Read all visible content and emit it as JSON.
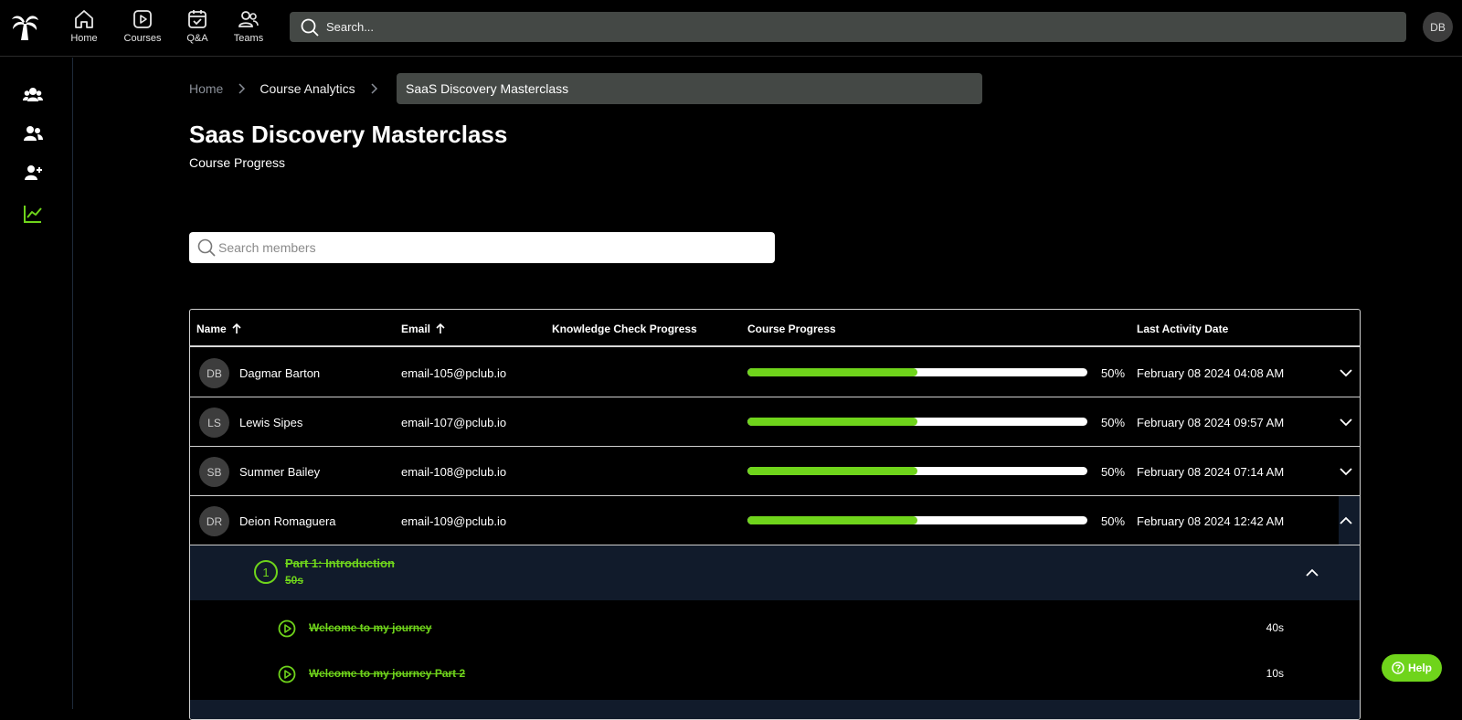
{
  "topnav": {
    "items": [
      {
        "label": "Home",
        "icon": "home-icon"
      },
      {
        "label": "Courses",
        "icon": "play-icon"
      },
      {
        "label": "Q&A",
        "icon": "calendar-check-icon"
      },
      {
        "label": "Teams",
        "icon": "people-icon"
      }
    ],
    "search_placeholder": "Search...",
    "user_initials": "DB"
  },
  "sidebar": {
    "items": [
      {
        "icon": "group-icon"
      },
      {
        "icon": "users-icon"
      },
      {
        "icon": "user-plus-icon"
      },
      {
        "icon": "analytics-icon",
        "active": true
      }
    ],
    "accent": "#6fd41b"
  },
  "breadcrumb": {
    "home": "Home",
    "section": "Course Analytics",
    "current": "SaaS Discovery Masterclass"
  },
  "page": {
    "title": "Saas Discovery Masterclass",
    "subtitle": "Course Progress"
  },
  "member_search": {
    "placeholder": "Search members"
  },
  "table": {
    "headers": {
      "name": "Name",
      "email": "Email",
      "knowledge": "Knowledge Check Progress",
      "progress": "Course Progress",
      "last_activity": "Last Activity Date"
    },
    "rows": [
      {
        "initials": "DB",
        "name": "Dagmar Barton",
        "email": "email-105@pclub.io",
        "progress": 50,
        "progress_label": "50%",
        "last_activity": "February 08 2024 04:08 AM",
        "expanded": false
      },
      {
        "initials": "LS",
        "name": "Lewis Sipes",
        "email": "email-107@pclub.io",
        "progress": 50,
        "progress_label": "50%",
        "last_activity": "February 08 2024 09:57 AM",
        "expanded": false
      },
      {
        "initials": "SB",
        "name": "Summer Bailey",
        "email": "email-108@pclub.io",
        "progress": 50,
        "progress_label": "50%",
        "last_activity": "February 08 2024 07:14 AM",
        "expanded": false
      },
      {
        "initials": "DR",
        "name": "Deion Romaguera",
        "email": "email-109@pclub.io",
        "progress": 50,
        "progress_label": "50%",
        "last_activity": "February 08 2024 12:42 AM",
        "expanded": true
      }
    ],
    "expanded_detail": {
      "module": {
        "number": "1",
        "title": "Part 1: Introduction",
        "duration": "50s"
      },
      "lessons": [
        {
          "title": "Welcome to my journey",
          "duration": "40s"
        },
        {
          "title": "Welcome to my journey Part 2",
          "duration": "10s"
        }
      ]
    }
  },
  "help": {
    "label": "Help"
  },
  "colors": {
    "accent": "#6fd41b",
    "panel": "#111b2b",
    "search_bg": "#444845"
  }
}
